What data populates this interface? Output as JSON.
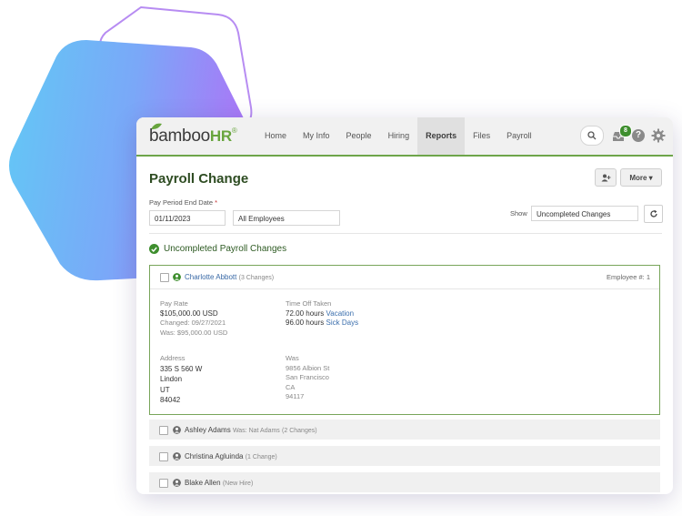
{
  "app": {
    "logo_text": "bamboo",
    "logo_hr": "HR",
    "logo_reg": "®"
  },
  "nav": {
    "items": [
      {
        "label": "Home"
      },
      {
        "label": "My Info"
      },
      {
        "label": "People"
      },
      {
        "label": "Hiring"
      },
      {
        "label": "Reports"
      },
      {
        "label": "Files"
      },
      {
        "label": "Payroll"
      }
    ],
    "active": "Reports",
    "inbox_count": "8",
    "help_symbol": "?"
  },
  "page": {
    "title": "Payroll Change",
    "more_label": "More ▾"
  },
  "filters": {
    "ppe_label": "Pay Period End Date",
    "ppe_required": "*",
    "ppe_value": "01/11/2023",
    "employees_value": "All Employees",
    "show_label": "Show",
    "show_value": "Uncompleted Changes"
  },
  "section": {
    "title": "Uncompleted Payroll Changes"
  },
  "expanded": {
    "name": "Charlotte Abbott",
    "changes": "(3 Changes)",
    "employee_number": "Employee #: 1",
    "pay_rate_label": "Pay Rate",
    "pay_rate_value": "$105,000.00 USD",
    "pay_rate_changed": "Changed: 09/27/2021",
    "pay_rate_was": "Was: $95,000.00 USD",
    "time_off_label": "Time Off Taken",
    "time_off_1_hours": "72.00 hours",
    "time_off_1_type": "Vacation",
    "time_off_2_hours": "96.00 hours",
    "time_off_2_type": "Sick Days",
    "address_label": "Address",
    "address_lines": [
      "335 S 560 W",
      "Lindon",
      "UT",
      "84042"
    ],
    "was_label": "Was",
    "was_lines": [
      "9856 Albion St",
      "San Francisco",
      "CA",
      "94117"
    ]
  },
  "rows": [
    {
      "name": "Ashley Adams",
      "sub": "Was: Nat Adams",
      "changes": "(2 Changes)"
    },
    {
      "name": "Christina Agluinda",
      "sub": "",
      "changes": "(1 Change)"
    },
    {
      "name": "Blake Allen",
      "sub": "",
      "changes": "(New Hire)"
    }
  ],
  "colors": {
    "brand_green": "#6ea54a",
    "title_green": "#2e4c22",
    "link_blue": "#3969a6",
    "badge_green": "#3e8e2e"
  }
}
